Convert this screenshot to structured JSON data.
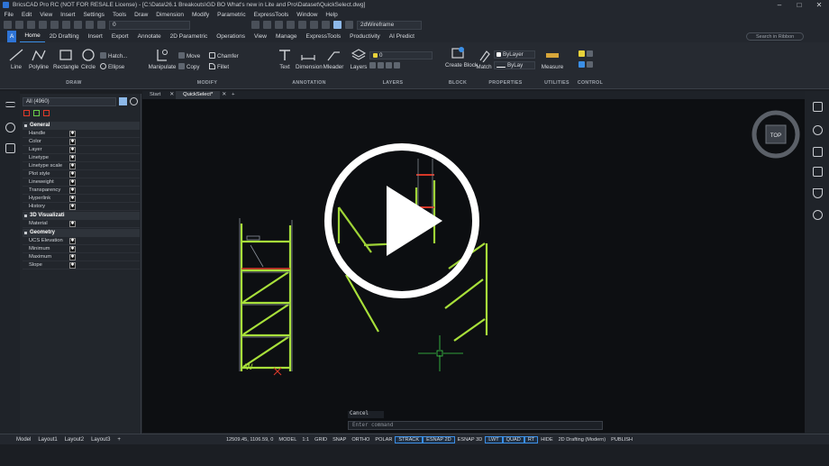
{
  "titlebar": {
    "title": "BricsCAD Pro RC (NOT FOR RESALE License) - [C:\\Data\\26.1 Breakouts\\GD BO What's new in Lite and Pro\\Dataset\\QuickSelect.dwg]",
    "min": "–",
    "max": "□",
    "close": "✕"
  },
  "menu": [
    "File",
    "Edit",
    "View",
    "Insert",
    "Settings",
    "Tools",
    "Draw",
    "Dimension",
    "Modify",
    "Parametric",
    "ExpressTools",
    "Window",
    "Help"
  ],
  "qat": {
    "layer_value": "0",
    "visual_style": "2dWireframe"
  },
  "ribbon_tabs": [
    "Home",
    "2D Drafting",
    "Insert",
    "Export",
    "Annotate",
    "2D Parametric",
    "Operations",
    "View",
    "Manage",
    "ExpressTools",
    "Productivity",
    "AI Predict"
  ],
  "active_tab": "Home",
  "search_ribbon_placeholder": "Search in Ribbon",
  "ribbon": {
    "draw": {
      "label": "DRAW",
      "line": "Line",
      "polyline": "Polyline",
      "rectangle": "Rectangle",
      "circle": "Circle",
      "hatch": "Hatch...",
      "ellipse": "Ellipse"
    },
    "modify": {
      "label": "MODIFY",
      "manipulate": "Manipulate",
      "move": "Move",
      "copy": "Copy",
      "chamfer": "Chamfer",
      "fillet": "Fillet"
    },
    "annotation": {
      "label": "ANNOTATION",
      "text": "Text",
      "dimension": "Dimension",
      "mleader": "Mleader"
    },
    "layers": {
      "label": "LAYERS",
      "layers": "Layers",
      "layer_value": "0"
    },
    "block": {
      "label": "BLOCK",
      "create_block": "Create Block"
    },
    "properties": {
      "label": "PROPERTIES",
      "match": "Match",
      "bylayer1": "ByLayer",
      "bylayer2": "ByLay"
    },
    "utilities": {
      "label": "UTILITIES",
      "measure": "Measure"
    },
    "control": {
      "label": "CONTROL"
    }
  },
  "doc_tabs": [
    "Start",
    "QuickSelect*"
  ],
  "active_doc_tab": "QuickSelect*",
  "panel": {
    "selection": "All (4960)",
    "categories": [
      {
        "name": "General",
        "rows": [
          "Handle",
          "Color",
          "Layer",
          "Linetype",
          "Linetype scale",
          "Plot style",
          "Lineweight",
          "Transparency",
          "Hyperlink",
          "History"
        ]
      },
      {
        "name": "3D Visualizati",
        "rows": [
          "Material"
        ]
      },
      {
        "name": "Geometry",
        "rows": [
          "UCS Elevation",
          "Minimum",
          "Maximum",
          "Slope"
        ]
      }
    ],
    "value_glyph": "✱"
  },
  "viewcube_label": "TOP",
  "drawing_mark": "W",
  "command": {
    "history": "Cancel",
    "placeholder": "Enter command"
  },
  "layout_tabs": [
    "Model",
    "Layout1",
    "Layout2",
    "Layout3"
  ],
  "add_layout": "+",
  "status": {
    "coords": "12509.45, 1106.59, 0",
    "items": [
      "MODEL",
      "1:1",
      "GRID",
      "SNAP",
      "ORTHO",
      "POLAR",
      "STRACK",
      "ESNAP 2D",
      "ESNAP 3D",
      "LWT",
      "QUAD",
      "RT",
      "HIDE",
      "2D Drafting (Modern)",
      "PUBLISH"
    ],
    "on_items": [
      "STRACK",
      "ESNAP 2D",
      "QUAD",
      "LWT",
      "RT"
    ]
  },
  "colors": {
    "accent": "#3b8fe6",
    "drawing_green": "#a8e03a",
    "drawing_red": "#e23a2a",
    "background": "#0d0f12"
  }
}
